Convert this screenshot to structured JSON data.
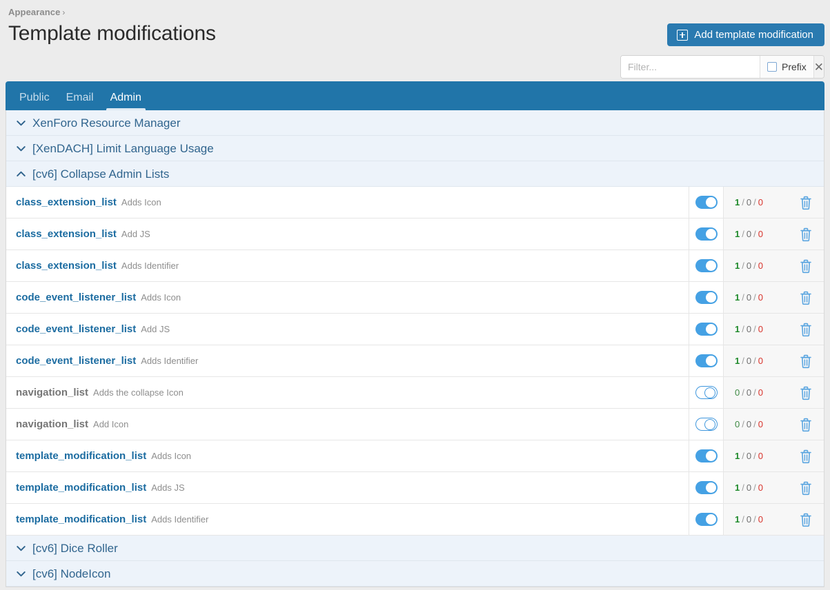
{
  "breadcrumb": {
    "parent": "Appearance",
    "separator": "›"
  },
  "page_title": "Template modifications",
  "toolbar": {
    "add_label": "Add template modification",
    "add_icon": "plus-square-icon",
    "accent_color": "#2a7ab0"
  },
  "filter": {
    "placeholder": "Filter...",
    "value": "",
    "prefix_label": "Prefix",
    "prefix_checked": false,
    "close_icon": "close-icon"
  },
  "tabs": [
    {
      "label": "Public",
      "active": false
    },
    {
      "label": "Email",
      "active": false
    },
    {
      "label": "Admin",
      "active": true
    }
  ],
  "list": [
    {
      "kind": "group",
      "label": "XenForo Resource Manager",
      "expanded": false,
      "icon": "chevron-down-icon"
    },
    {
      "kind": "group",
      "label": "[XenDACH] Limit Language Usage",
      "expanded": false,
      "icon": "chevron-down-icon"
    },
    {
      "kind": "group",
      "label": "[cv6] Collapse Admin Lists",
      "expanded": true,
      "icon": "chevron-up-icon"
    },
    {
      "kind": "mod",
      "name": "class_extension_list",
      "desc": "Adds Icon",
      "enabled": true,
      "counts": [
        "1",
        "0",
        "0"
      ],
      "delete_icon": "trash-icon"
    },
    {
      "kind": "mod",
      "name": "class_extension_list",
      "desc": "Add JS",
      "enabled": true,
      "counts": [
        "1",
        "0",
        "0"
      ],
      "delete_icon": "trash-icon"
    },
    {
      "kind": "mod",
      "name": "class_extension_list",
      "desc": "Adds Identifier",
      "enabled": true,
      "counts": [
        "1",
        "0",
        "0"
      ],
      "delete_icon": "trash-icon"
    },
    {
      "kind": "mod",
      "name": "code_event_listener_list",
      "desc": "Adds Icon",
      "enabled": true,
      "counts": [
        "1",
        "0",
        "0"
      ],
      "delete_icon": "trash-icon"
    },
    {
      "kind": "mod",
      "name": "code_event_listener_list",
      "desc": "Add JS",
      "enabled": true,
      "counts": [
        "1",
        "0",
        "0"
      ],
      "delete_icon": "trash-icon"
    },
    {
      "kind": "mod",
      "name": "code_event_listener_list",
      "desc": "Adds Identifier",
      "enabled": true,
      "counts": [
        "1",
        "0",
        "0"
      ],
      "delete_icon": "trash-icon"
    },
    {
      "kind": "mod",
      "name": "navigation_list",
      "desc": "Adds the collapse Icon",
      "enabled": false,
      "counts": [
        "0",
        "0",
        "0"
      ],
      "delete_icon": "trash-icon"
    },
    {
      "kind": "mod",
      "name": "navigation_list",
      "desc": "Add Icon",
      "enabled": false,
      "counts": [
        "0",
        "0",
        "0"
      ],
      "delete_icon": "trash-icon"
    },
    {
      "kind": "mod",
      "name": "template_modification_list",
      "desc": "Adds Icon",
      "enabled": true,
      "counts": [
        "1",
        "0",
        "0"
      ],
      "delete_icon": "trash-icon"
    },
    {
      "kind": "mod",
      "name": "template_modification_list",
      "desc": "Adds JS",
      "enabled": true,
      "counts": [
        "1",
        "0",
        "0"
      ],
      "delete_icon": "trash-icon"
    },
    {
      "kind": "mod",
      "name": "template_modification_list",
      "desc": "Adds Identifier",
      "enabled": true,
      "counts": [
        "1",
        "0",
        "0"
      ],
      "delete_icon": "trash-icon"
    },
    {
      "kind": "group",
      "label": "[cv6] Dice Roller",
      "expanded": false,
      "icon": "chevron-down-icon"
    },
    {
      "kind": "group",
      "label": "[cv6] NodeIcon",
      "expanded": false,
      "icon": "chevron-down-icon"
    }
  ]
}
